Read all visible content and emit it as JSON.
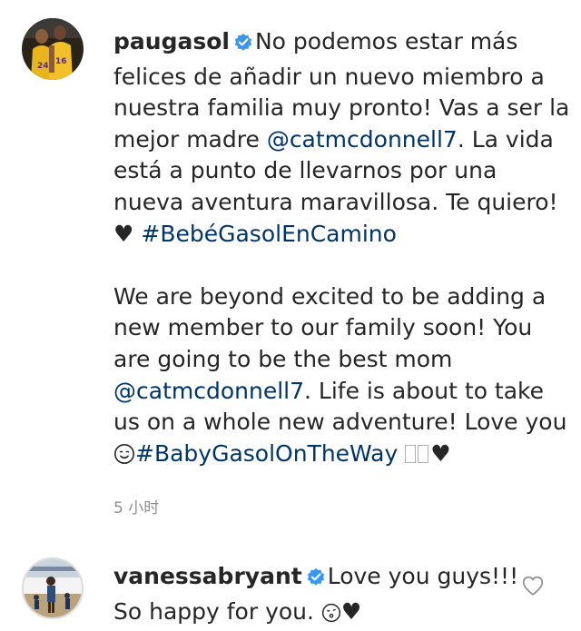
{
  "comments": [
    {
      "username": "paugasol",
      "lines": {
        "l1": "No podemos estar más",
        "l2": "felices de añadir un nuevo miembro a",
        "l3": "nuestra familia muy pronto! Vas a ser la",
        "l4_pre": "mejor madre ",
        "l4_mention": "@catmcdonnell7",
        "l4_post": ". La vida",
        "l5": "está a punto de llevarnos por una",
        "l6": "nueva aventura maravillosa. Te quiero!",
        "l7_heart": "♥",
        "l7_hashtag": "#BebéGasolEnCamino",
        "l9": "We are beyond excited to be adding a",
        "l10": "new member to our family soon! You",
        "l11": "are going to be the best mom",
        "l12_mention": "@catmcdonnell7",
        "l12_post": ". Life is about to take",
        "l13": "us on a whole new adventure! Love you",
        "l14_hashtag": "#BabyGasolOnTheWay",
        "l14_heart": "♥"
      },
      "timestamp": "5 小时"
    },
    {
      "username": "vanessabryant",
      "lines": {
        "l1": "Love you guys!!!",
        "l2": "So happy for you.",
        "l2_heart": "♥"
      }
    }
  ],
  "colors": {
    "text": "#262626",
    "link": "#003569",
    "muted": "#8e8e8e",
    "verified": "#3897f0"
  },
  "icons": {
    "verified": "verified-badge-icon",
    "like": "heart-outline-icon"
  }
}
